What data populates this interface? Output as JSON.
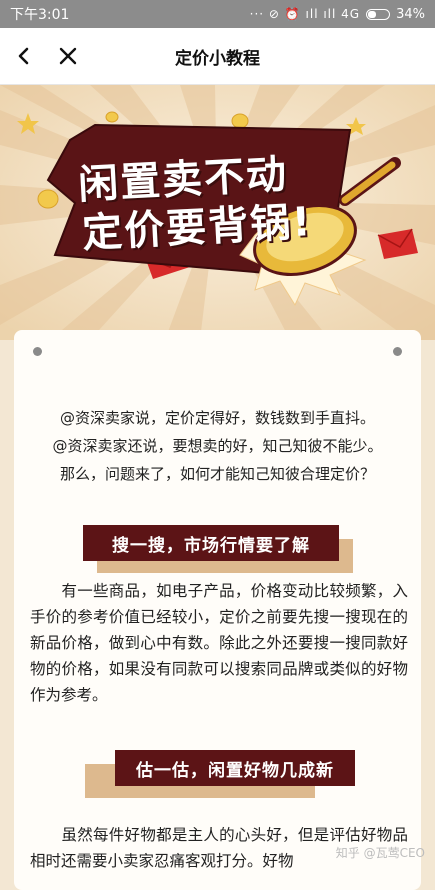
{
  "status_bar": {
    "time": "下午3:01",
    "icons_text": "··· ⊘ ⏰ ıll ıll 4G",
    "battery_percent": "34%",
    "battery_level": 0.34,
    "background": "#8c8c8c"
  },
  "nav": {
    "back_icon": "chevron-left-icon",
    "close_icon": "close-icon",
    "title": "定价小教程"
  },
  "banner": {
    "title_line1": "闲置卖不动",
    "title_line2": "定价要背锅!",
    "colors": {
      "accent": "#5c1416",
      "background": "#f1e0c4",
      "gold": "#e8b93a"
    }
  },
  "intro": {
    "lines": [
      "@资深卖家说，定价定得好，数钱数到手直抖。",
      "@资深卖家还说，要想卖的好，知己知彼不能少。",
      "那么，问题来了，如何才能知己知彼合理定价？"
    ]
  },
  "sections": [
    {
      "heading": "搜一搜，市场行情要了解",
      "paragraph": "　　有一些商品，如电子产品，价格变动比较频繁，入手价的参考价值已经较小，定价之前要先搜一搜现在的新品价格，做到心中有数。除此之外还要搜一搜同款好物的价格，如果没有同款可以搜索同品牌或类似的好物作为参考。"
    },
    {
      "heading": "估一估，闲置好物几成新",
      "paragraph": "　　虽然每件好物都是主人的心头好，但是评估好物品相时还需要小卖家忍痛客观打分。好物"
    }
  ],
  "watermark": "知乎 @瓦莺CEO"
}
